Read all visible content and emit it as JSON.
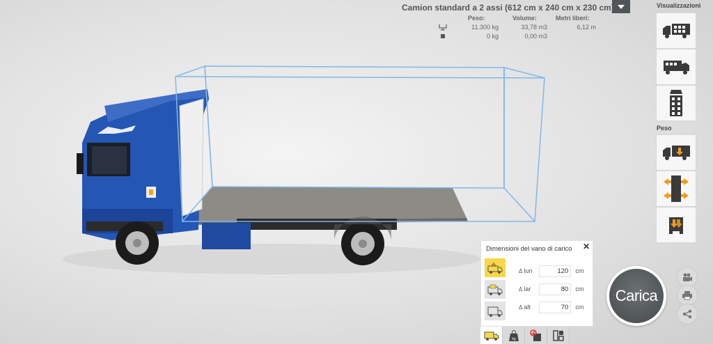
{
  "truck": {
    "title": "Camion standard a 2 assi (612 cm x 240 cm x 230 cm)"
  },
  "stats": {
    "headers": {
      "weight": "Peso:",
      "volume": "Volume:",
      "free_meters": "Metri liberi:"
    },
    "rows": [
      {
        "icon": "scale-icon",
        "weight": "11.300 kg",
        "volume": "33,78 m3",
        "free_meters": "6,12 m"
      },
      {
        "icon": "box-icon",
        "weight": "0 kg",
        "volume": "0,00 m3",
        "free_meters": ""
      }
    ]
  },
  "side": {
    "views_label": "Visualizzazioni",
    "weight_label": "Peso"
  },
  "dialog": {
    "title": "Dimensioni del vano di carico",
    "close": "✕",
    "fields": [
      {
        "label": "lun",
        "value": "120",
        "unit": "cm"
      },
      {
        "label": "lar",
        "value": "80",
        "unit": "cm"
      },
      {
        "label": "alt",
        "value": "70",
        "unit": "cm"
      }
    ]
  },
  "carica": {
    "label": "Carica"
  },
  "colors": {
    "truck_blue": "#1f4fa8",
    "wireframe": "#7fb8e8",
    "accent_yellow": "#f6d84a",
    "orange_arrow": "#f29a1d"
  }
}
